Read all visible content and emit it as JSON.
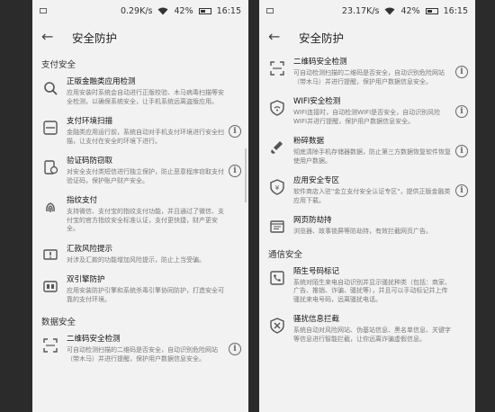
{
  "left": {
    "status": {
      "speed": "0.29K/s",
      "battery": "42%",
      "time": "16:15"
    },
    "title": "安全防护",
    "sections": [
      {
        "header": "支付安全",
        "items": [
          {
            "icon": "magnifier-icon",
            "title": "正版金融类应用检测",
            "desc": "应用安装时系统会自动进行正版校验、木马病毒扫描等安全检测，以确保系统安全，让手机系统远离盗版应用。",
            "info": false
          },
          {
            "icon": "scan-icon",
            "title": "支付环境扫描",
            "desc": "金融类应用运行前，系统自动对手机支付环境进行安全扫描，让支付在安全的环境下进行。",
            "info": true
          },
          {
            "icon": "verify-code-icon",
            "title": "验证码防窃取",
            "desc": "对安全支付类短信进行独立保护，防止恶意程序窃取支付验证码，保护账户财产安全。",
            "info": true
          },
          {
            "icon": "fingerprint-icon",
            "title": "指纹支付",
            "desc": "支持微信、支付宝的指纹支付功能，并且通过了微信、支付宝的官方指纹安全标准认证，支付更快捷，财产更安全。",
            "info": false
          },
          {
            "icon": "transfer-risk-icon",
            "title": "汇款风险提示",
            "desc": "对涉及汇款的功能增加风险提示，防止上当受骗。",
            "info": false
          },
          {
            "icon": "dual-engine-icon",
            "title": "双引擎防护",
            "desc": "应用安装防护引擎和系统杀毒引擎协同防护，打造安全可靠的支付环境。",
            "info": false
          }
        ]
      },
      {
        "header": "数据安全",
        "items": [
          {
            "icon": "qr-scan-icon",
            "title": "二维码安全检测",
            "desc": "可自动检测扫描的二维码是否安全，自动识别危险网站（带木马）并进行提醒，保护用户数据信息安全。",
            "info": true
          }
        ]
      }
    ]
  },
  "right": {
    "status": {
      "speed": "23.17K/s",
      "battery": "42%",
      "time": "16:15"
    },
    "title": "安全防护",
    "sections": [
      {
        "header": "",
        "items": [
          {
            "icon": "qr-scan-icon",
            "title": "二维码安全检测",
            "desc": "可自动检测扫描的二维码是否安全，自动识别危险网站（带木马）并进行提醒，保护用户数据信息安全。",
            "info": true
          },
          {
            "icon": "wifi-shield-icon",
            "title": "WIFI安全检测",
            "desc": "WIFI连接时，自动检测WIFI是否安全，自动识别风险WIFI并进行提醒，保护用户数据信息安全。",
            "info": true
          },
          {
            "icon": "shredder-icon",
            "title": "粉碎数据",
            "desc": "彻底清除手机存储器数据，防止第三方数据恢复软件恢复使用户数据。",
            "info": true
          },
          {
            "icon": "app-zone-icon",
            "title": "应用安全专区",
            "desc": "软件商店入驻\"金立支付安全认证专区\"，提供正版金融类应用下载。",
            "info": true
          },
          {
            "icon": "web-block-icon",
            "title": "网页防劫持",
            "desc": "浏览器、故事锁屏等防劫持，有效拦截网页广告。",
            "info": false
          }
        ]
      },
      {
        "header": "通信安全",
        "items": [
          {
            "icon": "stranger-number-icon",
            "title": "陌生号码标记",
            "desc": "系统对陌生来电自动识别并显示骚扰种类（包括：商家、广告、推销、诈骗、骚扰等），并且可以手动标记并上传骚扰来电号码，远离骚扰电话。",
            "info": false
          },
          {
            "icon": "harass-block-icon",
            "title": "骚扰信息拦截",
            "desc": "系统自动对风险网站、伪基站信息、黑名单信息、关键字等信息进行智能拦截，让你远离诈骗虚假信息。",
            "info": false
          }
        ]
      }
    ]
  }
}
